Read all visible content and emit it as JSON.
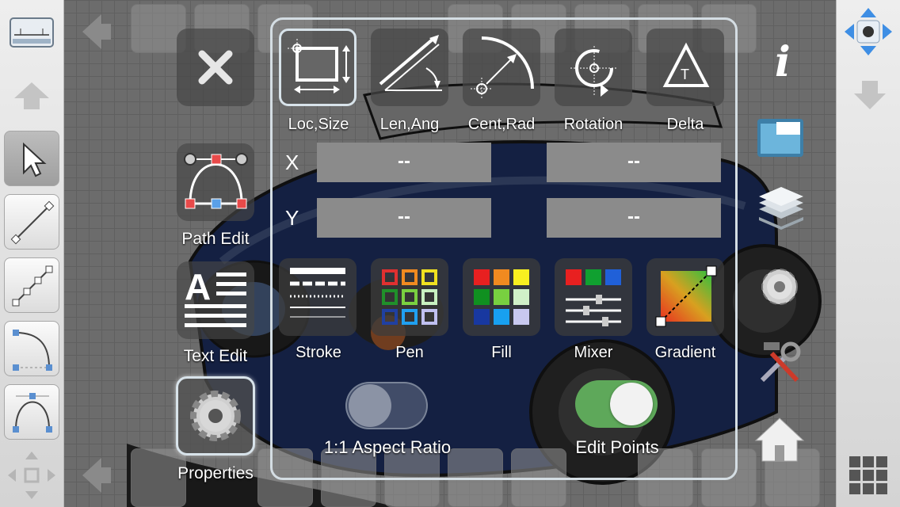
{
  "panel": {
    "tabs": [
      {
        "label": "Loc,Size",
        "icon": "loc-size-icon",
        "selected": true
      },
      {
        "label": "Len,Ang",
        "icon": "length-angle-icon",
        "selected": false
      },
      {
        "label": "Cent,Rad",
        "icon": "center-radius-icon",
        "selected": false
      },
      {
        "label": "Rotation",
        "icon": "rotation-icon",
        "selected": false
      },
      {
        "label": "Delta",
        "icon": "delta-icon",
        "selected": false
      }
    ],
    "x_label": "X",
    "y_label": "Y",
    "x_value_1": "--",
    "x_value_2": "--",
    "y_value_1": "--",
    "y_value_2": "--",
    "options": [
      {
        "label": "Stroke",
        "icon": "stroke-icon"
      },
      {
        "label": "Pen",
        "icon": "pen-palette-icon"
      },
      {
        "label": "Fill",
        "icon": "fill-palette-icon"
      },
      {
        "label": "Mixer",
        "icon": "mixer-icon"
      },
      {
        "label": "Gradient",
        "icon": "gradient-icon"
      }
    ],
    "aspect_ratio": {
      "label": "1:1 Aspect Ratio",
      "on": false
    },
    "edit_points": {
      "label": "Edit Points",
      "on": true
    }
  },
  "modes": [
    {
      "label": "Path Edit",
      "icon": "path-edit-icon"
    },
    {
      "label": "Text Edit",
      "icon": "text-edit-icon"
    },
    {
      "label": "Properties",
      "icon": "gear-icon",
      "selected": true
    }
  ],
  "colors": {
    "accent_toggle_on": "#5ea85a",
    "panel_border": "#d4dde3",
    "field_bg": "#8b8b8b"
  }
}
